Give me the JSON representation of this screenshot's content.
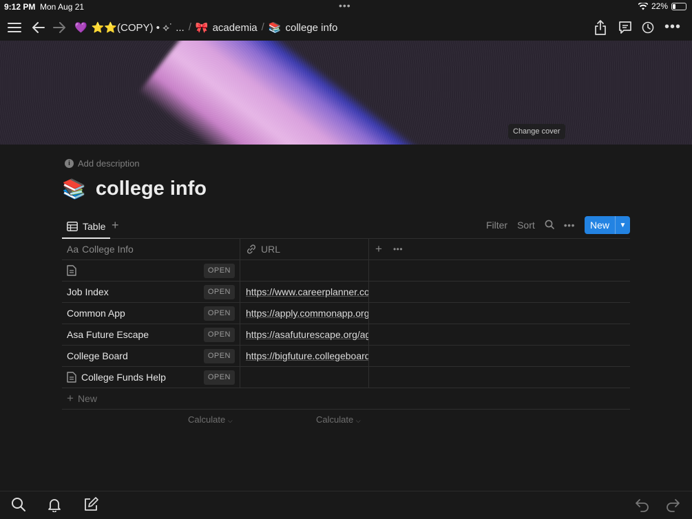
{
  "status_bar": {
    "time": "9:12 PM",
    "date": "Mon Aug 21",
    "battery": "22%",
    "battery_level": 0.22
  },
  "nav": {
    "breadcrumbs": [
      {
        "emoji": "💜",
        "label": "⭐⭐(COPY) • ⟡˙ ..."
      },
      {
        "emoji": "🎀",
        "label": "academia"
      },
      {
        "emoji": "📚",
        "label": "college info"
      }
    ],
    "icons": [
      "menu-icon",
      "back-arrow-icon",
      "forward-arrow-icon",
      "share-icon",
      "comment-icon",
      "history-icon",
      "more-icon"
    ]
  },
  "cover": {
    "change_label": "Change cover"
  },
  "page": {
    "add_description": "Add description",
    "icon": "📚",
    "title": "college info"
  },
  "view": {
    "tab_label": "Table",
    "filter": "Filter",
    "sort": "Sort",
    "new_label": "New"
  },
  "table": {
    "headers": {
      "title": "College Info",
      "url": "URL"
    },
    "open_label": "OPEN",
    "rows": [
      {
        "title": "",
        "url": "",
        "has_doc_icon": true
      },
      {
        "title": "Job Index",
        "url": "https://www.careerplanner.cor",
        "has_doc_icon": false
      },
      {
        "title": "Common App",
        "url": "https://apply.commonapp.org/",
        "has_doc_icon": false
      },
      {
        "title": "Asa Future Escape",
        "url": "https://asafuturescape.org/ag",
        "has_doc_icon": false
      },
      {
        "title": "College Board",
        "url": "https://bigfuture.collegeboard",
        "has_doc_icon": false
      },
      {
        "title": "College Funds Help",
        "url": "",
        "has_doc_icon": true
      }
    ],
    "new_row": "New",
    "calculate": "Calculate"
  }
}
